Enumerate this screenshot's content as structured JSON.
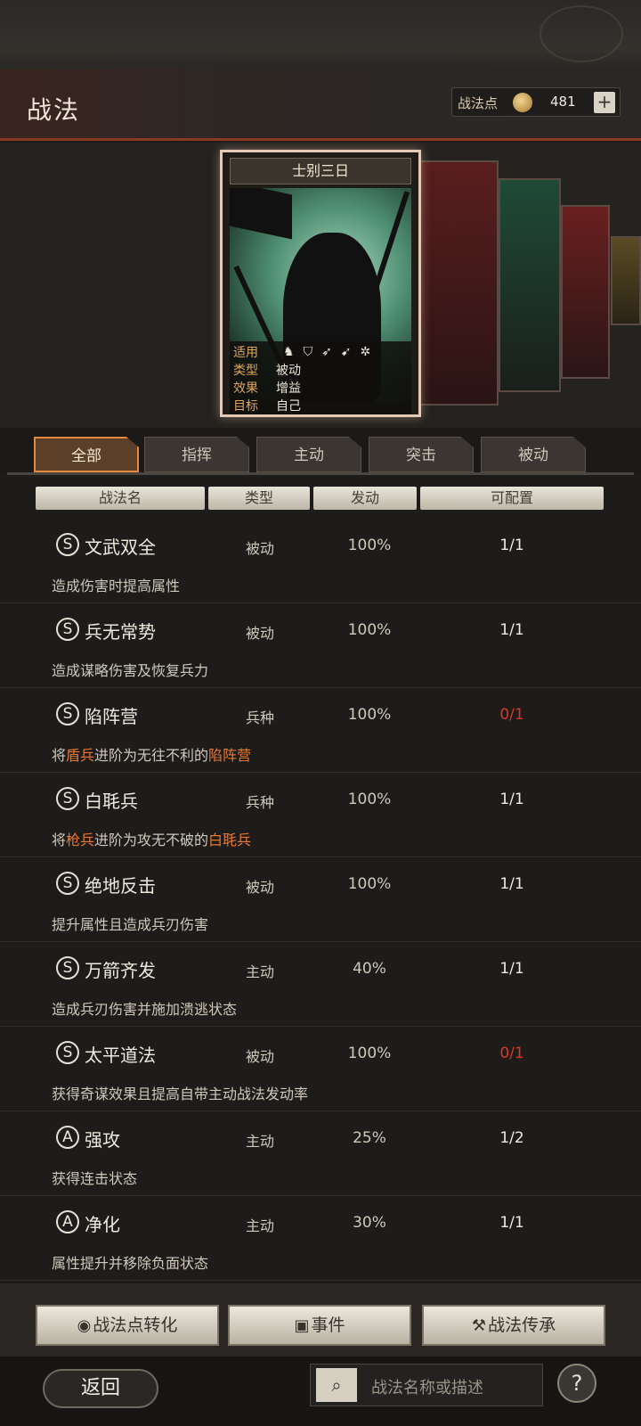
{
  "header": {
    "title": "战法",
    "points_label": "战法点",
    "points_value": "481",
    "plus": "+"
  },
  "card": {
    "name": "士别三日",
    "stats": [
      {
        "key": "适用",
        "value": ""
      },
      {
        "key": "类型",
        "value": "被动"
      },
      {
        "key": "效果",
        "value": "增益"
      },
      {
        "key": "目标",
        "value": "自己"
      }
    ],
    "applicable_icons": [
      "cavalry-icon",
      "shield-icon",
      "bow-icon",
      "spear-icon",
      "wheel-icon"
    ]
  },
  "tabs": [
    "全部",
    "指挥",
    "主动",
    "突击",
    "被动"
  ],
  "columns": [
    "战法名",
    "类型",
    "发动",
    "可配置"
  ],
  "rows": [
    {
      "grade": "S",
      "name": "文武双全",
      "type": "被动",
      "rate": "100%",
      "cfg": "1/1",
      "cfg_red": false,
      "desc": [
        {
          "t": "造成伤害时提高属性"
        }
      ]
    },
    {
      "grade": "S",
      "name": "兵无常势",
      "type": "被动",
      "rate": "100%",
      "cfg": "1/1",
      "cfg_red": false,
      "desc": [
        {
          "t": "造成谋略伤害及恢复兵力"
        }
      ]
    },
    {
      "grade": "S",
      "name": "陷阵营",
      "type": "兵种",
      "rate": "100%",
      "cfg": "0/1",
      "cfg_red": true,
      "desc": [
        {
          "t": "将"
        },
        {
          "t": "盾兵",
          "hl": true
        },
        {
          "t": "进阶为无往不利的"
        },
        {
          "t": "陷阵营",
          "hl": true
        }
      ]
    },
    {
      "grade": "S",
      "name": "白毦兵",
      "type": "兵种",
      "rate": "100%",
      "cfg": "1/1",
      "cfg_red": false,
      "desc": [
        {
          "t": "将"
        },
        {
          "t": "枪兵",
          "hl": true
        },
        {
          "t": "进阶为攻无不破的"
        },
        {
          "t": "白毦兵",
          "hl": true
        }
      ]
    },
    {
      "grade": "S",
      "name": "绝地反击",
      "type": "被动",
      "rate": "100%",
      "cfg": "1/1",
      "cfg_red": false,
      "desc": [
        {
          "t": "提升属性且造成兵刃伤害"
        }
      ]
    },
    {
      "grade": "S",
      "name": "万箭齐发",
      "type": "主动",
      "rate": "40%",
      "cfg": "1/1",
      "cfg_red": false,
      "desc": [
        {
          "t": "造成兵刃伤害并施加溃逃状态"
        }
      ]
    },
    {
      "grade": "S",
      "name": "太平道法",
      "type": "被动",
      "rate": "100%",
      "cfg": "0/1",
      "cfg_red": true,
      "desc": [
        {
          "t": "获得奇谋效果且提高自带主动战法发动率"
        }
      ]
    },
    {
      "grade": "A",
      "name": "强攻",
      "type": "主动",
      "rate": "25%",
      "cfg": "1/2",
      "cfg_red": false,
      "desc": [
        {
          "t": "获得连击状态"
        }
      ]
    },
    {
      "grade": "A",
      "name": "净化",
      "type": "主动",
      "rate": "30%",
      "cfg": "1/1",
      "cfg_red": false,
      "desc": [
        {
          "t": "属性提升并移除负面状态"
        }
      ]
    }
  ],
  "buttons": {
    "convert": "战法点转化",
    "event": "事件",
    "inherit": "战法传承"
  },
  "footer": {
    "back": "返回",
    "search_placeholder": "战法名称或描述",
    "help": "?"
  }
}
